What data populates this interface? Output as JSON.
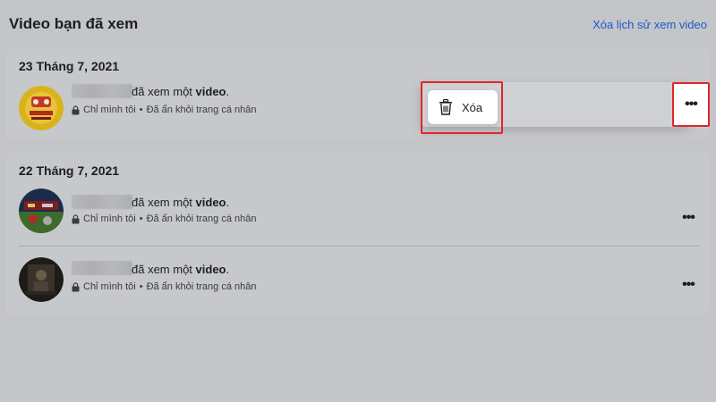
{
  "header": {
    "title": "Video bạn đã xem",
    "clear_history": "Xóa lịch sử xem video"
  },
  "groups": [
    {
      "date": "23 Tháng 7, 2021",
      "items": [
        {
          "activity_prefix": "đã xem một ",
          "activity_object": "video",
          "activity_suffix": ".",
          "privacy": "Chỉ mình tôi",
          "separator": "•",
          "status": "Đã ẩn khỏi trang cá nhân",
          "more_icon": "more-icon"
        }
      ]
    },
    {
      "date": "22 Tháng 7, 2021",
      "items": [
        {
          "activity_prefix": "đã xem một ",
          "activity_object": "video",
          "activity_suffix": ".",
          "privacy": "Chỉ mình tôi",
          "separator": "•",
          "status": "Đã ẩn khỏi trang cá nhân",
          "more_icon": "more-icon"
        },
        {
          "activity_prefix": "đã xem một ",
          "activity_object": "video",
          "activity_suffix": ".",
          "privacy": "Chỉ mình tôi",
          "separator": "•",
          "status": "Đã ẩn khỏi trang cá nhân",
          "more_icon": "more-icon"
        }
      ]
    }
  ],
  "menu": {
    "delete_label": "Xóa",
    "delete_icon": "trash-icon",
    "more_glyph": "•••"
  },
  "colors": {
    "accent_link": "#1b5bc7",
    "highlight_border": "#e0262b",
    "overlay_bg": "#c4c5c9"
  }
}
